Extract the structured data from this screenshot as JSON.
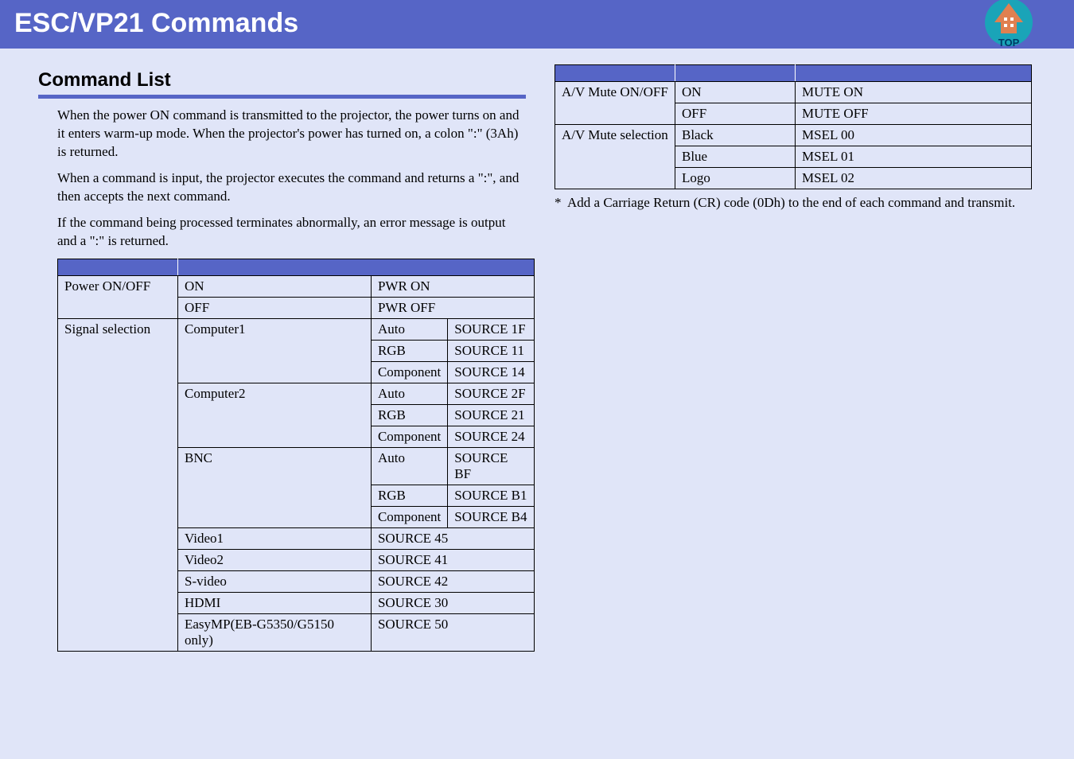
{
  "header": {
    "title": "ESC/VP21 Commands",
    "top_icon_label": "TOP"
  },
  "section": {
    "heading": "Command List"
  },
  "paragraphs": {
    "p1": "When the power ON command is transmitted to the projector, the power turns on and it enters warm-up mode. When the projector's power has turned on, a colon \":\" (3Ah) is returned.",
    "p2": "When a command is input, the projector executes the command and returns a \":\", and then accepts the next command.",
    "p3": "If the command being processed terminates abnormally, an error message is output and a \":\" is returned."
  },
  "table1": {
    "rows": [
      {
        "item": "Power ON/OFF",
        "sub": "ON",
        "cmd": "PWR ON"
      },
      {
        "item": "",
        "sub": "OFF",
        "cmd": "PWR OFF"
      },
      {
        "item": "Signal selection",
        "sub": "Computer1",
        "detail": "Auto",
        "cmd": "SOURCE 1F"
      },
      {
        "item": "",
        "sub": "",
        "detail": "RGB",
        "cmd": "SOURCE 11"
      },
      {
        "item": "",
        "sub": "",
        "detail": "Component",
        "cmd": "SOURCE 14"
      },
      {
        "item": "",
        "sub": "Computer2",
        "detail": "Auto",
        "cmd": "SOURCE 2F"
      },
      {
        "item": "",
        "sub": "",
        "detail": "RGB",
        "cmd": "SOURCE 21"
      },
      {
        "item": "",
        "sub": "",
        "detail": "Component",
        "cmd": "SOURCE 24"
      },
      {
        "item": "",
        "sub": "BNC",
        "detail": "Auto",
        "cmd": "SOURCE BF"
      },
      {
        "item": "",
        "sub": "",
        "detail": "RGB",
        "cmd": "SOURCE B1"
      },
      {
        "item": "",
        "sub": "",
        "detail": "Component",
        "cmd": "SOURCE B4"
      },
      {
        "item": "",
        "sub": "Video1",
        "cmd": "SOURCE 45"
      },
      {
        "item": "",
        "sub": "Video2",
        "cmd": "SOURCE 41"
      },
      {
        "item": "",
        "sub": "S-video",
        "cmd": "SOURCE 42"
      },
      {
        "item": "",
        "sub": "HDMI",
        "cmd": "SOURCE 30"
      },
      {
        "item": "",
        "sub": "EasyMP(EB-G5350/G5150 only)",
        "cmd": "SOURCE 50"
      }
    ]
  },
  "table2": {
    "rows": [
      {
        "item": "A/V Mute ON/OFF",
        "sub": "ON",
        "cmd": "MUTE ON"
      },
      {
        "item": "",
        "sub": "OFF",
        "cmd": "MUTE OFF"
      },
      {
        "item": "A/V Mute selection",
        "sub": "Black",
        "cmd": "MSEL 00"
      },
      {
        "item": "",
        "sub": "Blue",
        "cmd": "MSEL 01"
      },
      {
        "item": "",
        "sub": "Logo",
        "cmd": "MSEL 02"
      }
    ]
  },
  "footnote": {
    "star": "*",
    "text": "Add a Carriage Return (CR) code (0Dh) to the end of each command and transmit."
  }
}
